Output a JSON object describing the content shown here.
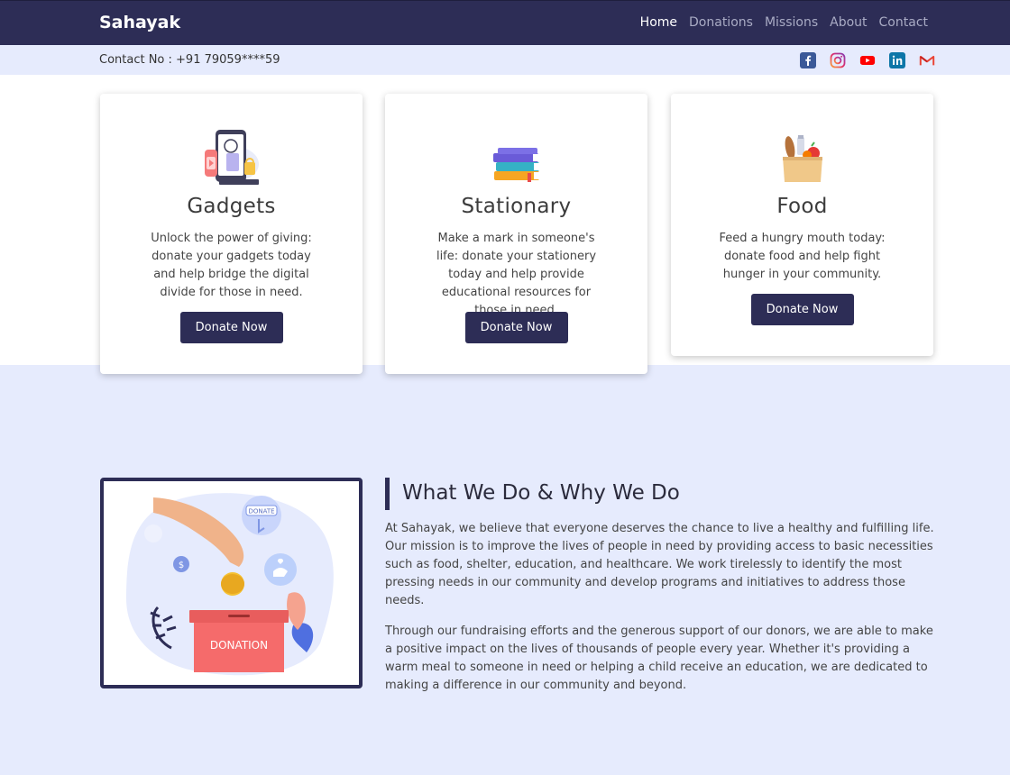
{
  "header": {
    "brand": "Sahayak",
    "nav": [
      {
        "label": "Home",
        "active": true
      },
      {
        "label": "Donations",
        "active": false
      },
      {
        "label": "Missions",
        "active": false
      },
      {
        "label": "About",
        "active": false
      },
      {
        "label": "Contact",
        "active": false
      }
    ]
  },
  "contact_bar": {
    "text": "Contact No : +91 79059****59",
    "socials": [
      "facebook-icon",
      "instagram-icon",
      "youtube-icon",
      "linkedin-icon",
      "gmail-icon"
    ]
  },
  "cards": [
    {
      "title": "Gadgets",
      "description": "Unlock the power of giving: donate your gadgets today and help bridge the digital divide for those in need.",
      "button": "Donate Now",
      "icon": "gadgets-icon"
    },
    {
      "title": "Stationary",
      "description": "Make a mark in someone's life: donate your stationery today and help provide educational resources for those in need.",
      "button": "Donate Now",
      "icon": "books-icon"
    },
    {
      "title": "Food",
      "description": "Feed a hungry mouth today: donate food and help fight hunger in your community.",
      "button": "Donate Now",
      "icon": "grocery-bag-icon"
    }
  ],
  "about": {
    "title": "What We Do & Why We Do",
    "paragraphs": [
      "At Sahayak, we believe that everyone deserves the chance to live a healthy and fulfilling life. Our mission is to improve the lives of people in need by providing access to basic necessities such as food, shelter, education, and healthcare. We work tirelessly to identify the most pressing needs in our community and develop programs and initiatives to address those needs.",
      "Through our fundraising efforts and the generous support of our donors, we are able to make a positive impact on the lives of thousands of people every year. Whether it's providing a warm meal to someone in need or helping a child receive an education, we are dedicated to making a difference in our community and beyond."
    ],
    "illustration": {
      "box_label": "DONATION",
      "bubble_label": "DONATE"
    }
  },
  "colors": {
    "navy": "#2d2d56",
    "page_bg": "#e6ebfd",
    "donation_box": "#f56b6b"
  }
}
